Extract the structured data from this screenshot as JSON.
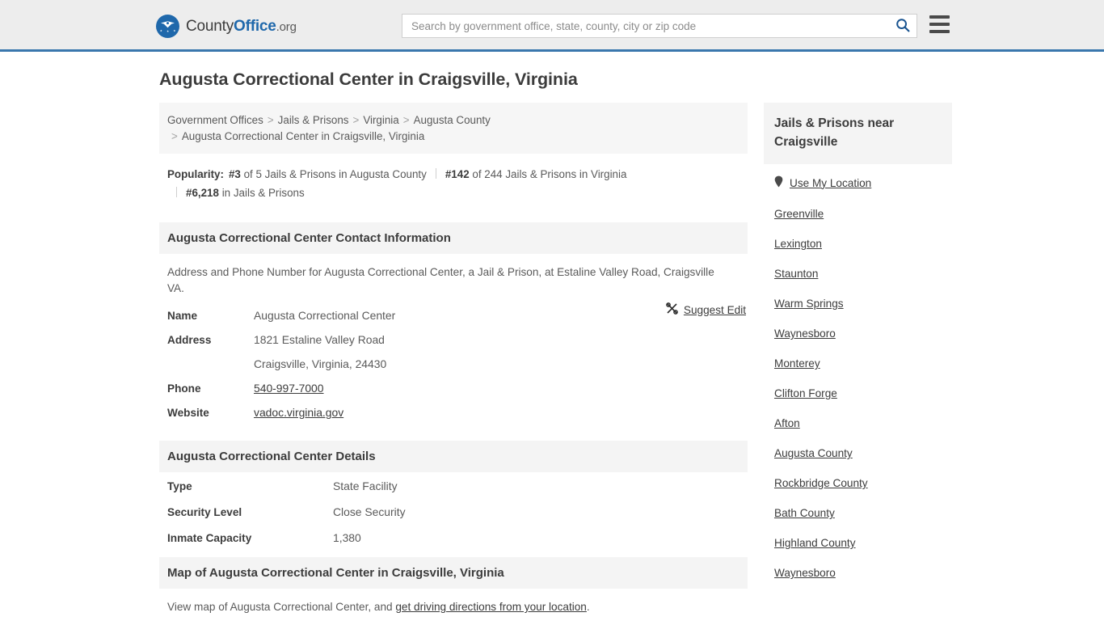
{
  "header": {
    "logo": {
      "icon": "eagle-shield-logo-icon",
      "text_county": "County",
      "text_office": "Office",
      "text_org": ".org"
    },
    "search": {
      "placeholder": "Search by government office, state, county, city or zip code",
      "value": "",
      "search_icon": "search-icon"
    },
    "menu_icon": "hamburger-menu-icon",
    "accent_color": "#3a77ad"
  },
  "page": {
    "title": "Augusta Correctional Center in Craigsville, Virginia"
  },
  "breadcrumb": {
    "separator": ">",
    "items": [
      "Government Offices",
      "Jails & Prisons",
      "Virginia",
      "Augusta County",
      "Augusta Correctional Center in Craigsville, Virginia"
    ]
  },
  "popularity": {
    "label": "Popularity:",
    "entries": [
      {
        "rank": "#3",
        "text": "of 5 Jails & Prisons in Augusta County"
      },
      {
        "rank": "#142",
        "text": "of 244 Jails & Prisons in Virginia"
      },
      {
        "rank": "#6,218",
        "text": "in Jails & Prisons"
      }
    ]
  },
  "contact": {
    "heading": "Augusta Correctional Center Contact Information",
    "description": "Address and Phone Number for Augusta Correctional Center, a Jail & Prison, at Estaline Valley Road, Craigsville VA.",
    "suggest_edit": {
      "label": "Suggest Edit",
      "icon": "edit-suggest-icon"
    },
    "rows": [
      {
        "key": "Name",
        "value": "Augusta Correctional Center",
        "link": false
      },
      {
        "key": "Address",
        "value": "1821 Estaline Valley Road",
        "link": false
      },
      {
        "key": "",
        "value": "Craigsville, Virginia, 24430",
        "link": false
      },
      {
        "key": "Phone",
        "value": "540-997-7000",
        "link": true
      },
      {
        "key": "Website",
        "value": "vadoc.virginia.gov",
        "link": true
      }
    ]
  },
  "details": {
    "heading": "Augusta Correctional Center Details",
    "rows": [
      {
        "key": "Type",
        "value": "State Facility"
      },
      {
        "key": "Security Level",
        "value": "Close Security"
      },
      {
        "key": "Inmate Capacity",
        "value": "1,380"
      }
    ]
  },
  "map": {
    "heading": "Map of Augusta Correctional Center in Craigsville, Virginia",
    "note_prefix": "View map of Augusta Correctional Center, and ",
    "note_link": "get driving directions from your location",
    "note_suffix": "."
  },
  "sidebar": {
    "heading": "Jails & Prisons near Craigsville",
    "use_my_location": {
      "label": "Use My Location",
      "icon": "map-pin-icon"
    },
    "links": [
      "Greenville",
      "Lexington",
      "Staunton",
      "Warm Springs",
      "Waynesboro",
      "Monterey",
      "Clifton Forge",
      "Afton",
      "Augusta County",
      "Rockbridge County",
      "Bath County",
      "Highland County",
      "Waynesboro"
    ]
  }
}
